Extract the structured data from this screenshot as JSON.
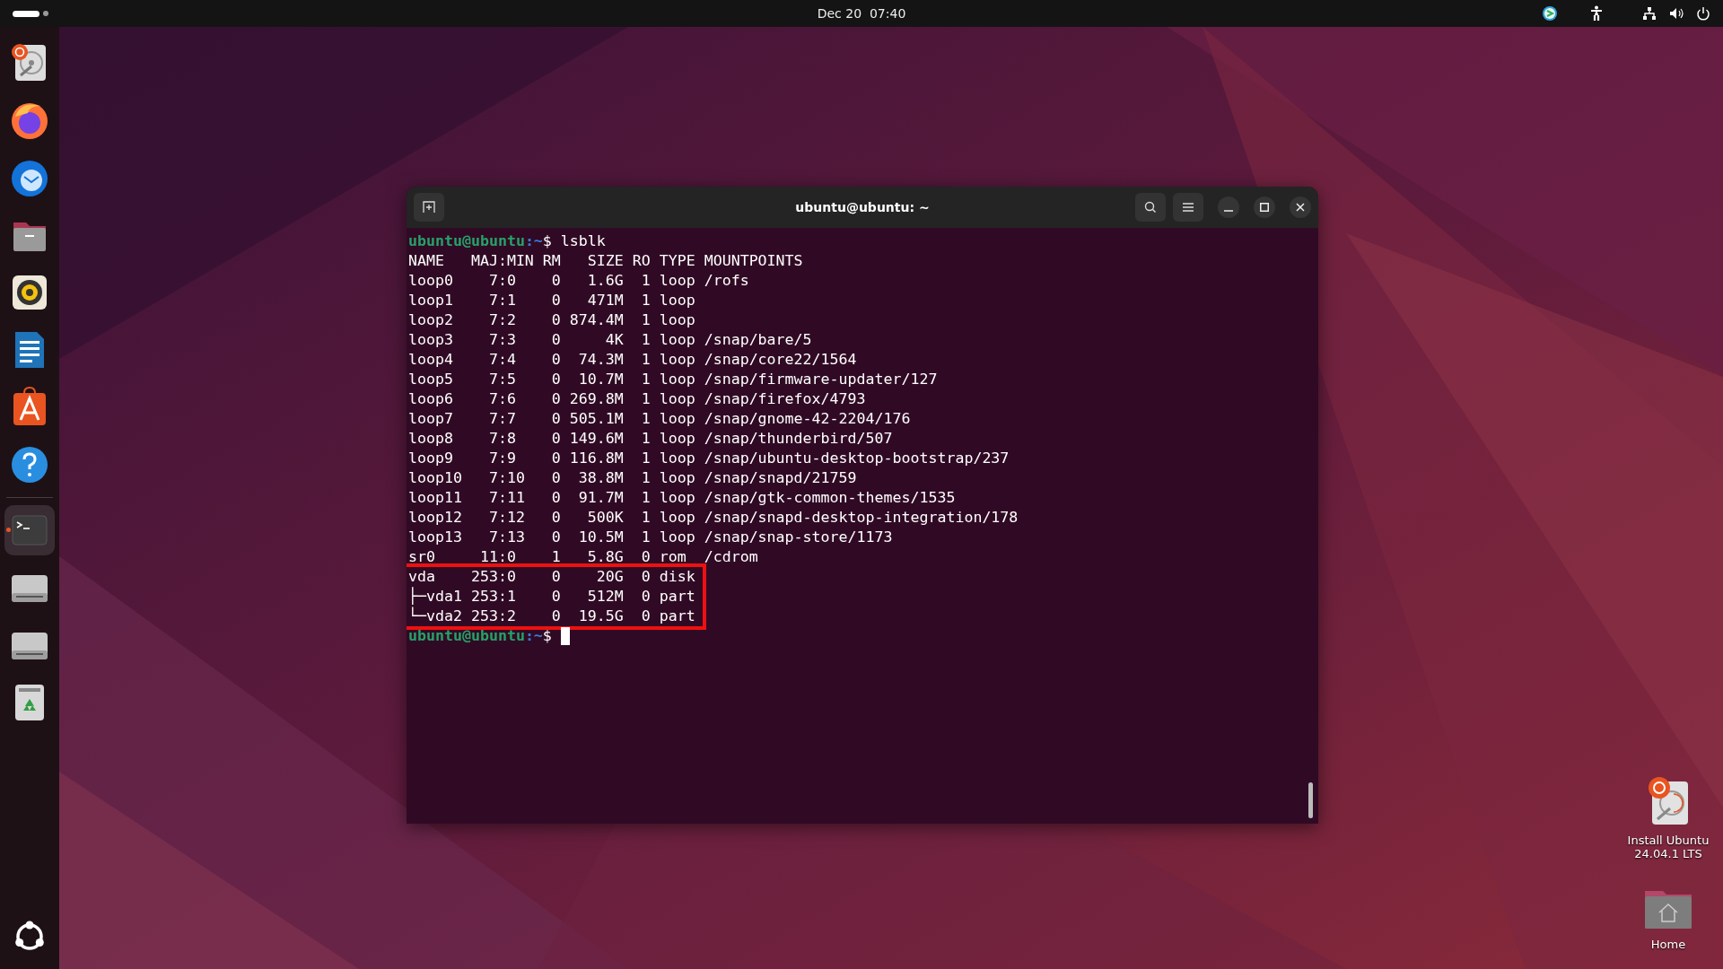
{
  "top_bar": {
    "clock": "Dec 20  07:40"
  },
  "dock": [
    {
      "running": false
    },
    {
      "running": false
    },
    {
      "running": false
    },
    {
      "running": false
    },
    {
      "running": false
    },
    {
      "running": false
    },
    {
      "running": false
    },
    {
      "running": false
    },
    {
      "running": true
    },
    {
      "running": false
    },
    {
      "running": false
    },
    {
      "running": false
    }
  ],
  "terminal": {
    "title": "ubuntu@ubuntu: ~",
    "blocks": [
      {
        "highlighted": false,
        "lines": [
          {
            "kind": "prompt",
            "user": "ubuntu@ubuntu",
            "path": ":~",
            "sign": "$",
            "command": "lsblk"
          },
          {
            "kind": "output",
            "text": "NAME   MAJ:MIN RM   SIZE RO TYPE MOUNTPOINTS"
          },
          {
            "kind": "output",
            "text": "loop0    7:0    0   1.6G  1 loop /rofs"
          },
          {
            "kind": "output",
            "text": "loop1    7:1    0   471M  1 loop"
          },
          {
            "kind": "output",
            "text": "loop2    7:2    0 874.4M  1 loop"
          },
          {
            "kind": "output",
            "text": "loop3    7:3    0     4K  1 loop /snap/bare/5"
          },
          {
            "kind": "output",
            "text": "loop4    7:4    0  74.3M  1 loop /snap/core22/1564"
          },
          {
            "kind": "output",
            "text": "loop5    7:5    0  10.7M  1 loop /snap/firmware-updater/127"
          },
          {
            "kind": "output",
            "text": "loop6    7:6    0 269.8M  1 loop /snap/firefox/4793"
          },
          {
            "kind": "output",
            "text": "loop7    7:7    0 505.1M  1 loop /snap/gnome-42-2204/176"
          },
          {
            "kind": "output",
            "text": "loop8    7:8    0 149.6M  1 loop /snap/thunderbird/507"
          },
          {
            "kind": "output",
            "text": "loop9    7:9    0 116.8M  1 loop /snap/ubuntu-desktop-bootstrap/237"
          },
          {
            "kind": "output",
            "text": "loop10   7:10   0  38.8M  1 loop /snap/snapd/21759"
          },
          {
            "kind": "output",
            "text": "loop11   7:11   0  91.7M  1 loop /snap/gtk-common-themes/1535"
          },
          {
            "kind": "output",
            "text": "loop12   7:12   0   500K  1 loop /snap/snapd-desktop-integration/178"
          },
          {
            "kind": "output",
            "text": "loop13   7:13   0  10.5M  1 loop /snap/snap-store/1173"
          },
          {
            "kind": "output",
            "text": "sr0     11:0    1   5.8G  0 rom  /cdrom"
          }
        ]
      },
      {
        "highlighted": true,
        "lines": [
          {
            "kind": "output",
            "text": "vda    253:0    0    20G  0 disk"
          },
          {
            "kind": "output",
            "text": "├─vda1 253:1    0   512M  0 part"
          },
          {
            "kind": "output",
            "text": "└─vda2 253:2    0  19.5G  0 part"
          }
        ]
      },
      {
        "highlighted": false,
        "lines": [
          {
            "kind": "prompt",
            "user": "ubuntu@ubuntu",
            "path": ":~",
            "sign": "$"
          }
        ]
      }
    ],
    "cursor": true
  },
  "desktop_icons": [
    {
      "kind": "installer",
      "label": "Install Ubuntu 24.04.1 LTS"
    },
    {
      "kind": "home",
      "label": "Home"
    }
  ]
}
